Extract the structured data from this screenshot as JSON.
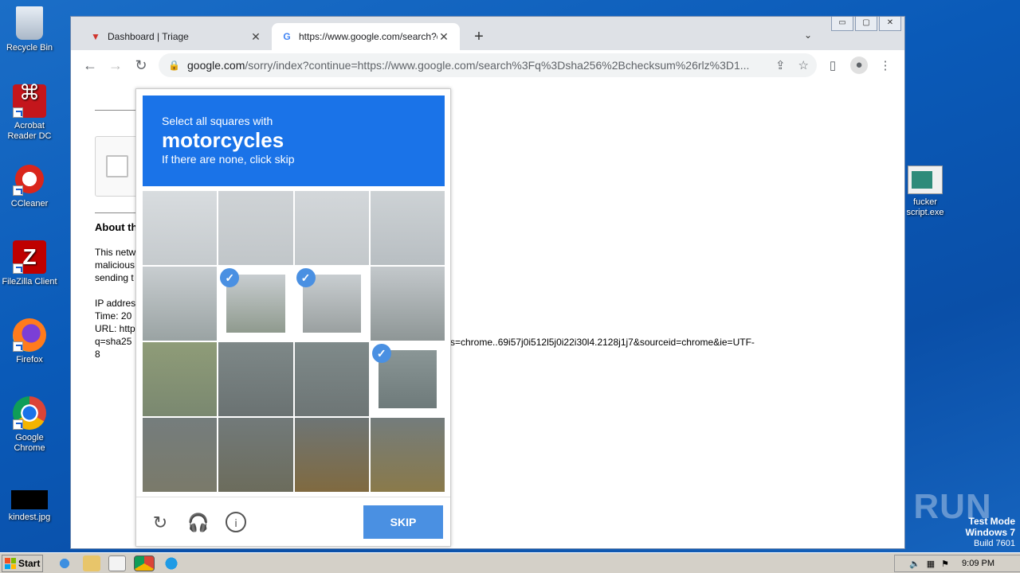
{
  "desktop": {
    "icons": [
      {
        "label": "Recycle Bin"
      },
      {
        "label": "Acrobat Reader DC"
      },
      {
        "label": "CCleaner"
      },
      {
        "label": "FileZilla Client"
      },
      {
        "label": "Firefox"
      },
      {
        "label": "Google Chrome"
      },
      {
        "label": "kindest.jpg"
      },
      {
        "label": "fucker script.exe"
      }
    ],
    "watermark": "ANY RUN",
    "test_mode": {
      "line1": "Test Mode",
      "line2": "Windows 7",
      "line3": "Build 7601"
    }
  },
  "browser": {
    "tabs": [
      {
        "label": "Dashboard | Triage",
        "favicon": "triage-icon"
      },
      {
        "label": "https://www.google.com/search?q=",
        "favicon": "google-icon"
      }
    ],
    "url_domain": "google.com",
    "url_rest": "/sorry/index?continue=https://www.google.com/search%3Fq%3Dsha256%2Bchecksum%26rlz%3D1..."
  },
  "page": {
    "about_heading": "About th",
    "para1_l1": "This netw",
    "para1_l2": "malicious",
    "para1_l3": "sending t",
    "ip_label": "IP addres",
    "time_label": "Time: 20",
    "url_label": "URL: http",
    "q_label": "q=sha25",
    "q_cont": "8",
    "url_tail": "s=chrome..69i57j0i512l5j0i22i30l4.2128j1j7&sourceid=chrome&ie=UTF-"
  },
  "captcha": {
    "instruction": "Select all squares with",
    "target": "motorcycles",
    "hint": "If there are none, click skip",
    "selected_tiles": [
      5,
      6,
      11
    ],
    "skip_label": "SKIP"
  },
  "taskbar": {
    "start_label": "Start",
    "time": "9:09 PM"
  }
}
